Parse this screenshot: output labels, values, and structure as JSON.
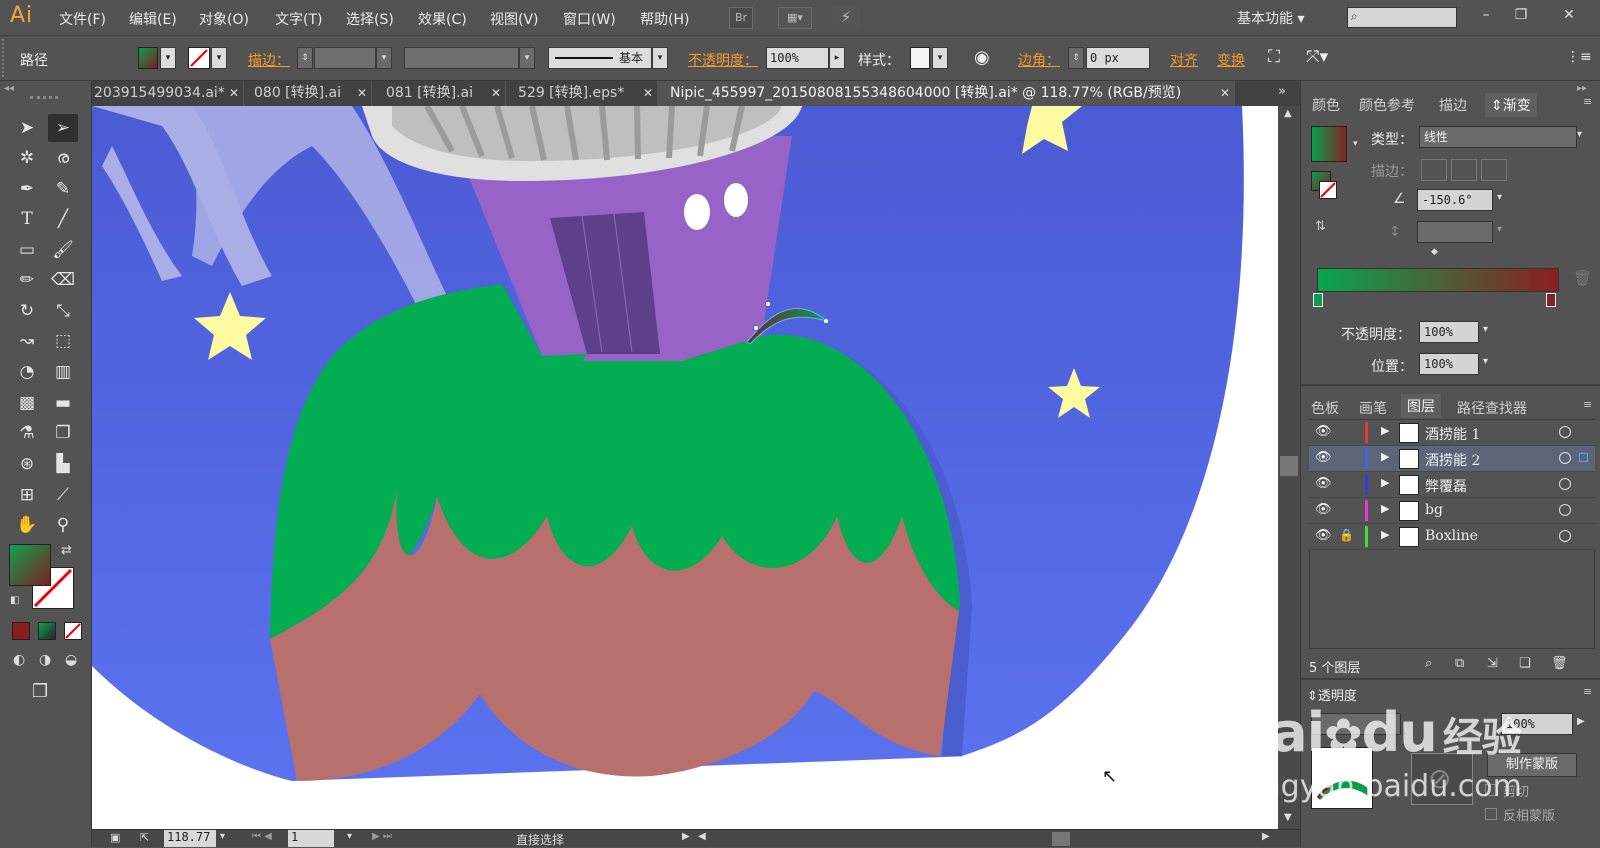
{
  "app": {
    "logo": "Ai",
    "menus": [
      "文件(F)",
      "编辑(E)",
      "对象(O)",
      "文字(T)",
      "选择(S)",
      "效果(C)",
      "视图(V)",
      "窗口(W)",
      "帮助(H)"
    ],
    "bridge_label": "Br",
    "workspace": "基本功能"
  },
  "control": {
    "object_type": "路径",
    "stroke_label": "描边：",
    "stroke_style": "基本",
    "opacity_label": "不透明度：",
    "opacity_value": "100%",
    "style_label": "样式：",
    "corner_label": "边角：",
    "corner_value": "0 px",
    "align_label": "对齐",
    "transform_label": "变换"
  },
  "tabs": [
    {
      "label": "203915499034.ai*"
    },
    {
      "label": "080 [转换].ai"
    },
    {
      "label": "081 [转换].ai"
    },
    {
      "label": "529 [转换].eps*"
    },
    {
      "label": "Nipic_455997_20150808155348604000 [转换].ai* @ 118.77% (RGB/预览)"
    }
  ],
  "status": {
    "zoom": "118.77",
    "page": "1",
    "tool": "直接选择"
  },
  "gradient_panel": {
    "tabs": [
      "颜色",
      "颜色参考",
      "描边",
      "渐变"
    ],
    "type_label": "类型：",
    "type_value": "线性",
    "stroke_label": "描边：",
    "angle": "-150.6°",
    "opacity_label": "不透明度：",
    "opacity_value": "100%",
    "position_label": "位置：",
    "position_value": "100%"
  },
  "layers_panel": {
    "tabs": [
      "色板",
      "画笔",
      "图层",
      "路径查找器"
    ],
    "layers": [
      {
        "name": "酒捞能 1",
        "color": "#e03a3a"
      },
      {
        "name": "酒捞能 2",
        "color": "#3a6ae0"
      },
      {
        "name": "弊覆磊",
        "color": "#3a3ae0"
      },
      {
        "name": "bg",
        "color": "#e03ae0"
      },
      {
        "name": "Boxline",
        "color": "#3ae03a"
      }
    ],
    "count": "5 个图层"
  },
  "transparency_panel": {
    "title": "透明度",
    "opacity_value": "100%",
    "make_mask": "制作蒙版",
    "clip": "剪切",
    "invert_mask": "反相蒙版"
  },
  "watermark": {
    "brand": "Bai",
    "brand2": "du",
    "cn": "经验",
    "url": "jingyan.baidu.com"
  },
  "colors": {
    "sky": "#5068e0",
    "grass": "#03ad52",
    "soil": "#b8706c",
    "tower": "#9863c7",
    "star": "#fefaa0"
  }
}
